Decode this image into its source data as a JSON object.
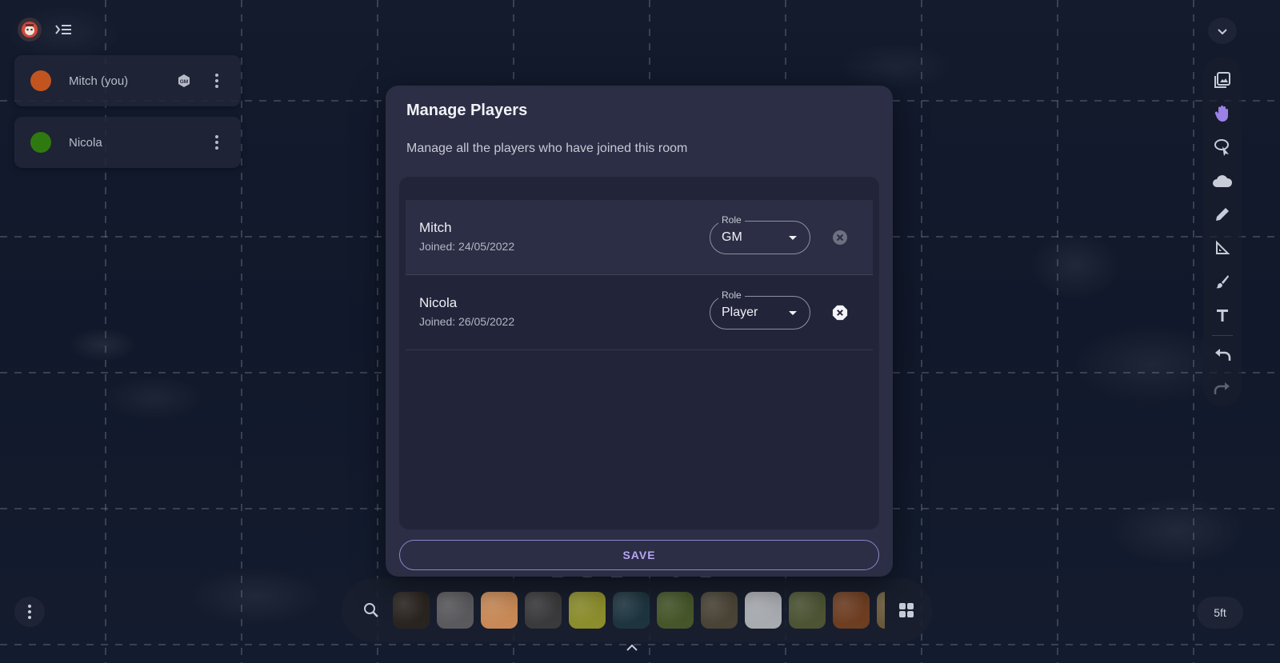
{
  "players": [
    {
      "name": "Mitch (you)",
      "color": "#c2541f",
      "badge": "GM"
    },
    {
      "name": "Nicola",
      "color": "#2f7a10"
    }
  ],
  "dialog": {
    "title": "Manage Players",
    "description": "Manage all the players who have joined this room",
    "role_label": "Role",
    "rows": [
      {
        "name": "Mitch",
        "joined": "Joined: 24/05/2022",
        "role": "GM"
      },
      {
        "name": "Nicola",
        "joined": "Joined: 26/05/2022",
        "role": "Player"
      }
    ],
    "save_label": "SAVE"
  },
  "map_scale": "5ft",
  "toolbar_icons": [
    "image-icon",
    "hand-icon",
    "lasso-pointer-icon",
    "fog-cloud-icon",
    "pencil-icon",
    "measure-icon",
    "brush-icon",
    "text-icon",
    "undo-icon",
    "redo-icon"
  ],
  "tiles": [
    "#2a2420",
    "#5a5a5e",
    "#c88956",
    "#3a3a3c",
    "#8c8d2c",
    "#1e3540",
    "#46562a",
    "#4a4436",
    "#a8abb0",
    "#4c5434",
    "#6e3e22",
    "#6a5a3a"
  ],
  "colors": {
    "accent": "#b7a6f3",
    "dialog_bg": "#2b2e45",
    "list_bg": "#22253a"
  }
}
